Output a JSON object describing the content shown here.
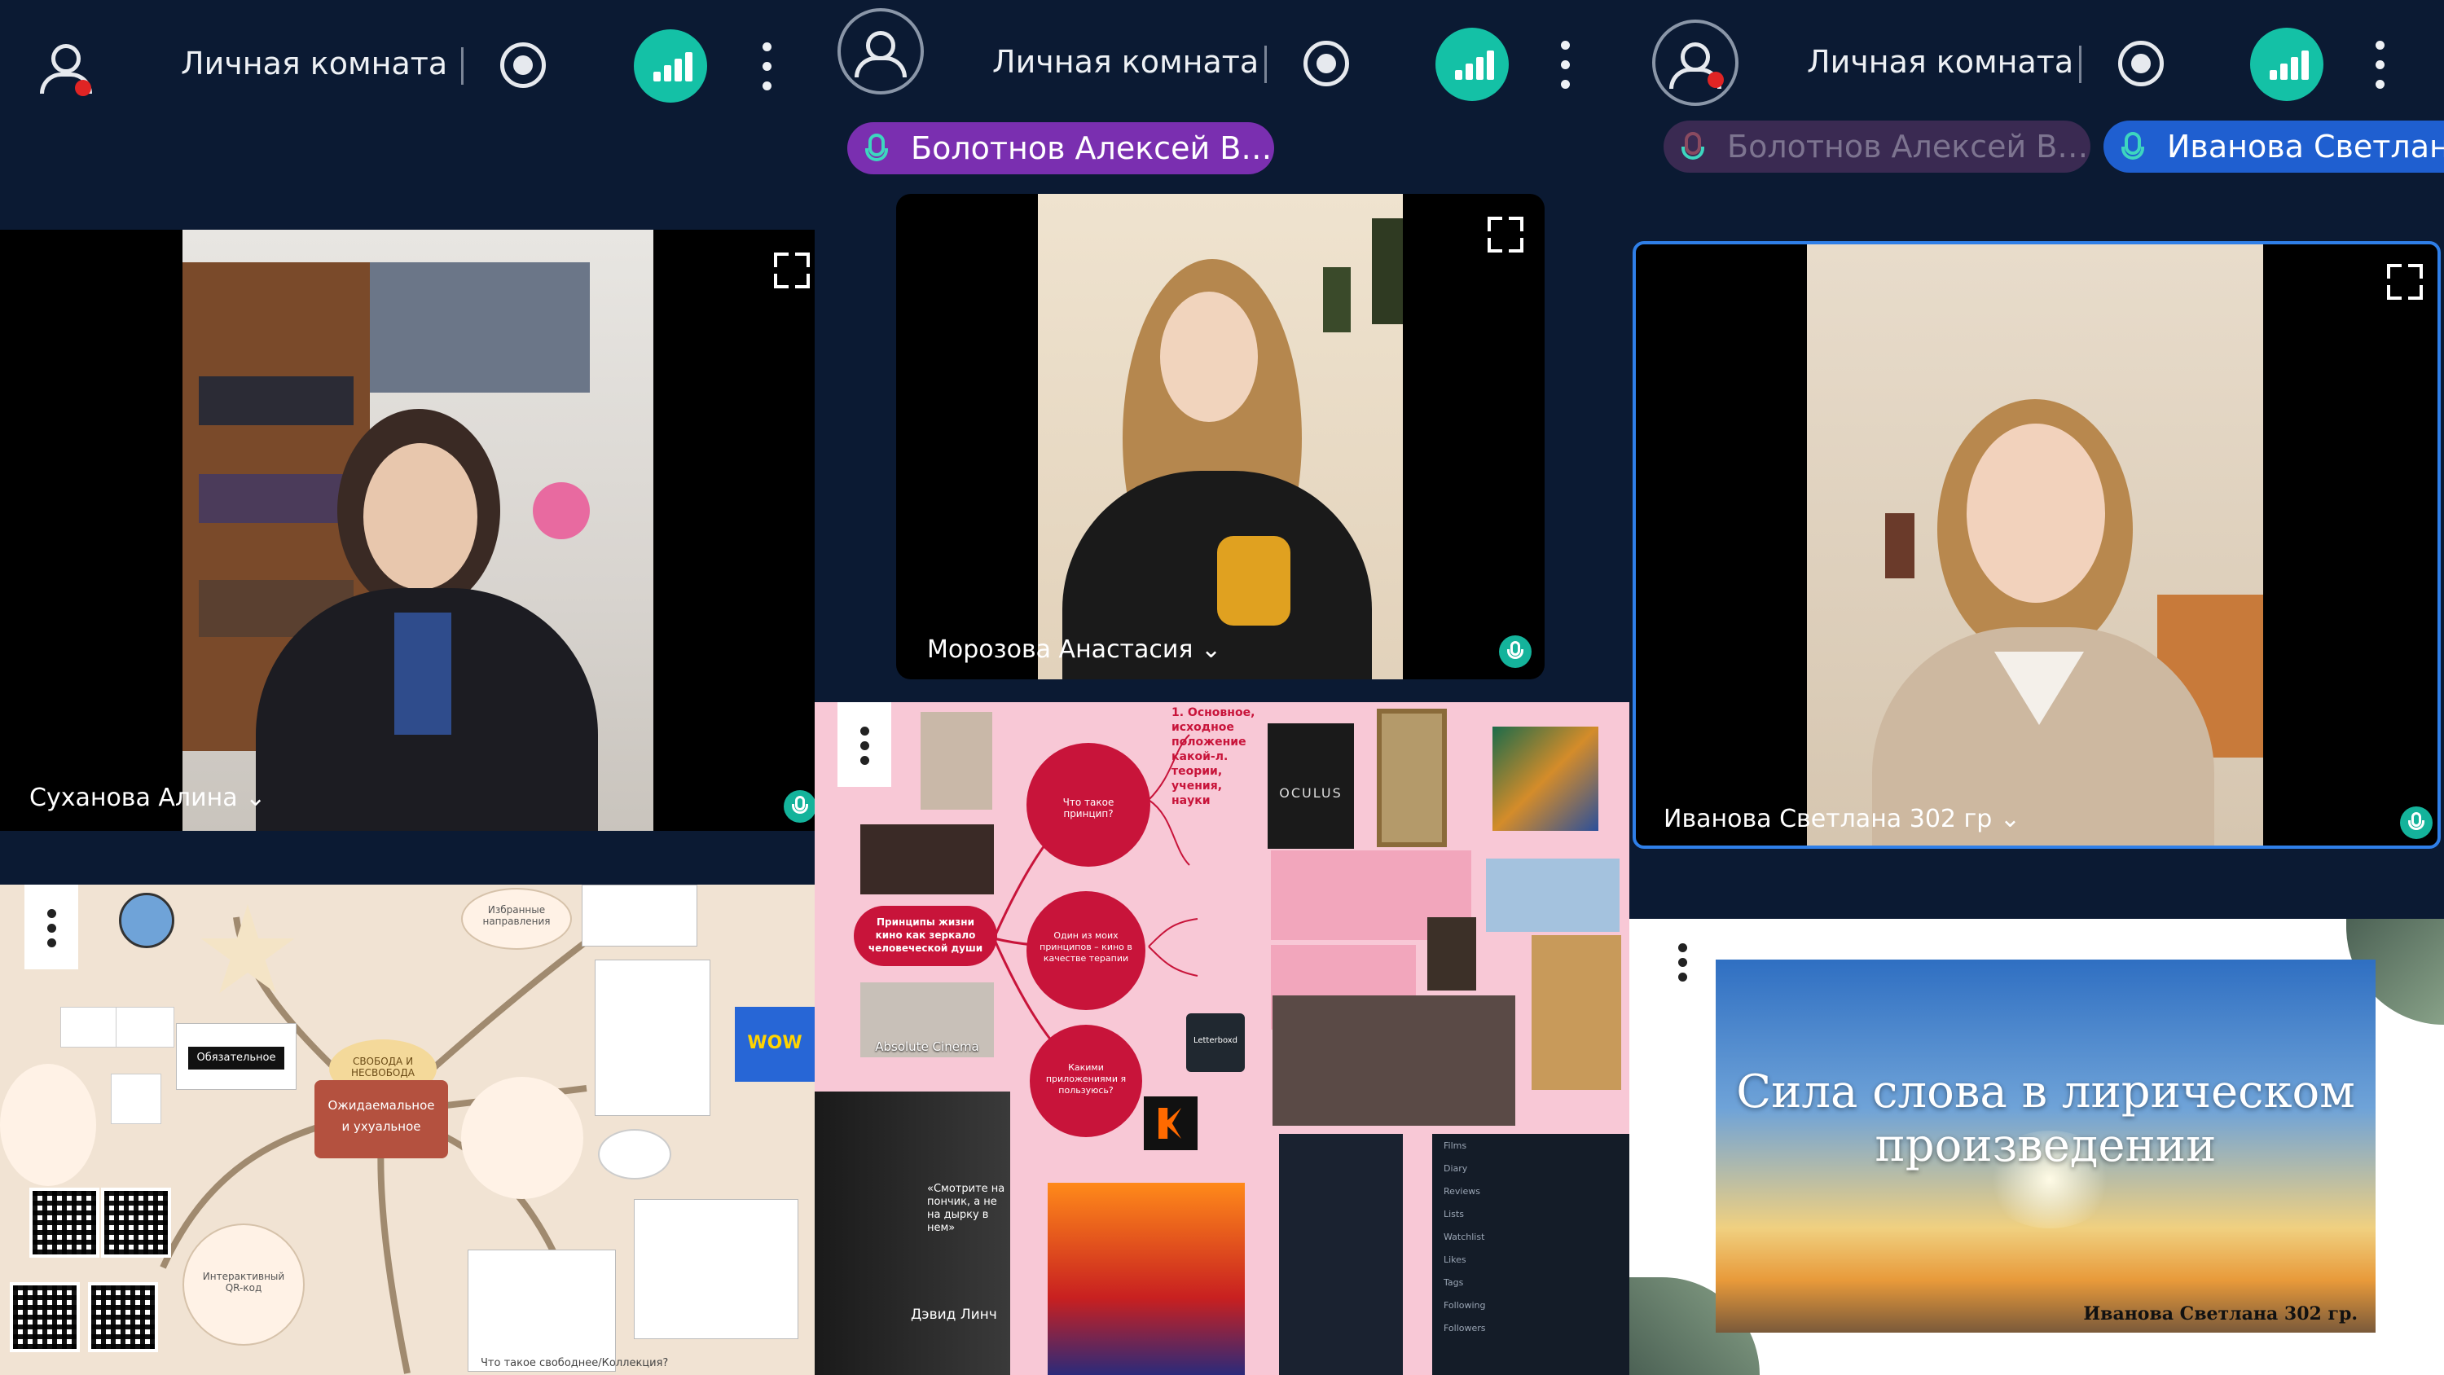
{
  "panels": [
    {
      "room_title": "Личная комната",
      "participant_name": "Суханова Алина",
      "name_chevron": "⌄",
      "share": {
        "labels": {
          "wow": "WOW",
          "hub_line1": "Ожидаемальное",
          "hub_line2": "и ухуальное",
          "bubble_top": "Избранные направления",
          "bubble_left": "СВОБОДА И НЕСВОБОДА",
          "qr_caption": "Интерактивный QR-код",
          "black_label": "Обязательное",
          "bottom_q": "Что такое свободнее/Коллекция?"
        }
      }
    },
    {
      "room_title": "Личная комната",
      "speaker_pill": "Болотнов Алексей В…",
      "participant_name": "Морозова Анастасия",
      "name_chevron": "⌄",
      "share": {
        "center_node": "Принципы жизни кино как зеркало человеческой души",
        "node_1": "Что такое принцип?",
        "node_2": "Один из моих принципов – кино в качестве терапии",
        "node_3": "Какими приложениями я пользуюсь?",
        "def_text": "1. Основное, исходное положение какой-л. теории, учения, науки",
        "movie_label": "OCULUS",
        "absolute_cinema": "Absolute Cinema",
        "lynch_quote": "«Смотрите на пончик, а не на дырку в нем»",
        "lynch_name": "Дэвид Линч",
        "letterboxd": "Letterboxd",
        "lb_rows": [
          "Films",
          "Diary",
          "Reviews",
          "Lists",
          "Watchlist",
          "Likes",
          "Tags",
          "Following",
          "Followers"
        ]
      }
    },
    {
      "room_title": "Личная комната",
      "speaker_pill_muted": "Болотнов Алексей В…",
      "speaker_pill_active": "Иванова Светлан",
      "participant_name": "Иванова Светлана 302 гр",
      "name_chevron": "⌄",
      "share": {
        "slide_title_line1": "Сила слова в лирическом",
        "slide_title_line2": "произведении",
        "slide_author": "Иванова Светлана 302 гр."
      }
    }
  ],
  "colors": {
    "bg": "#0b1a33",
    "accent_teal": "#14c1a6",
    "pill_purple": "#7a2fb0",
    "pill_blue": "#1f5fd0",
    "record_red": "#e02424",
    "mindmap_pink": "#f8c8d6",
    "node_crimson": "#c8143a"
  }
}
